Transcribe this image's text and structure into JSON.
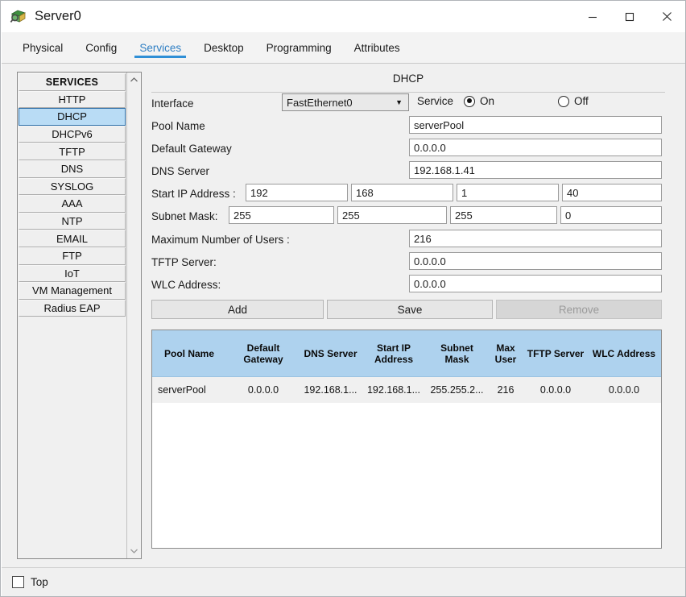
{
  "window": {
    "title": "Server0",
    "icon": "server-icon",
    "minimize_label": "—",
    "maximize_label": "□",
    "close_label": "✕"
  },
  "tabs": [
    {
      "label": "Physical",
      "active": false
    },
    {
      "label": "Config",
      "active": false
    },
    {
      "label": "Services",
      "active": true
    },
    {
      "label": "Desktop",
      "active": false
    },
    {
      "label": "Programming",
      "active": false
    },
    {
      "label": "Attributes",
      "active": false
    }
  ],
  "sidebar": {
    "header": "SERVICES",
    "items": [
      {
        "label": "HTTP",
        "selected": false
      },
      {
        "label": "DHCP",
        "selected": true
      },
      {
        "label": "DHCPv6",
        "selected": false
      },
      {
        "label": "TFTP",
        "selected": false
      },
      {
        "label": "DNS",
        "selected": false
      },
      {
        "label": "SYSLOG",
        "selected": false
      },
      {
        "label": "AAA",
        "selected": false
      },
      {
        "label": "NTP",
        "selected": false
      },
      {
        "label": "EMAIL",
        "selected": false
      },
      {
        "label": "FTP",
        "selected": false
      },
      {
        "label": "IoT",
        "selected": false
      },
      {
        "label": "VM Management",
        "selected": false
      },
      {
        "label": "Radius EAP",
        "selected": false
      }
    ],
    "scroll_up": "⌃",
    "scroll_down": "⌄"
  },
  "panel": {
    "title": "DHCP",
    "interface": {
      "label": "Interface",
      "value": "FastEthernet0",
      "options": [
        "FastEthernet0"
      ]
    },
    "service": {
      "label": "Service",
      "on_label": "On",
      "off_label": "Off",
      "selected": "On"
    },
    "pool_name": {
      "label": "Pool Name",
      "value": "serverPool"
    },
    "default_gateway": {
      "label": "Default Gateway",
      "value": "0.0.0.0"
    },
    "dns_server": {
      "label": "DNS Server",
      "value": "192.168.1.41"
    },
    "start_ip": {
      "label": "Start IP Address :",
      "octets": [
        "192",
        "168",
        "1",
        "40"
      ]
    },
    "subnet_mask": {
      "label": "Subnet Mask:",
      "octets": [
        "255",
        "255",
        "255",
        "0"
      ]
    },
    "max_users": {
      "label": "Maximum Number of Users :",
      "value": "216"
    },
    "tftp_server": {
      "label": "TFTP Server:",
      "value": "0.0.0.0"
    },
    "wlc_address": {
      "label": "WLC Address:",
      "value": "0.0.0.0"
    },
    "buttons": {
      "add": "Add",
      "save": "Save",
      "remove": "Remove",
      "remove_disabled": true
    }
  },
  "table": {
    "columns": [
      "Pool Name",
      "Default Gateway",
      "DNS Server",
      "Start IP Address",
      "Subnet Mask",
      "Max User",
      "TFTP Server",
      "WLC Address"
    ],
    "rows": [
      {
        "pool_name": "serverPool",
        "default_gateway": "0.0.0.0",
        "dns_server": "192.168.1...",
        "start_ip": "192.168.1...",
        "subnet_mask": "255.255.2...",
        "max_user": "216",
        "tftp_server": "0.0.0.0",
        "wlc_address": "0.0.0.0"
      }
    ]
  },
  "footer": {
    "top_checkbox_label": "Top",
    "top_checked": false
  },
  "colors": {
    "accent": "#2f8fd6",
    "table_header": "#aed2ee",
    "selection": "#b9dcf5"
  }
}
